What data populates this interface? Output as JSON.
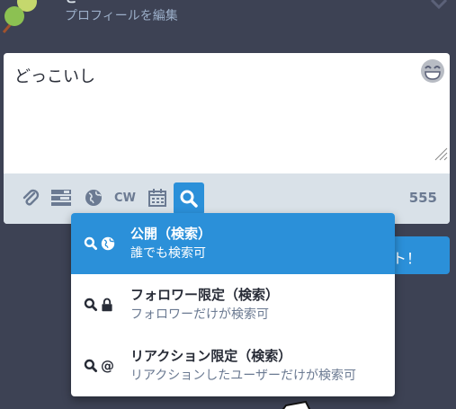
{
  "header": {
    "display_name": "さ",
    "edit_profile": "プロフィールを編集"
  },
  "compose": {
    "text": "どっこいし",
    "char_count": "555",
    "cw_label": "CW"
  },
  "toot_button": {
    "label": "ト！"
  },
  "visibility_menu": {
    "options": [
      {
        "title": "公開（検索）",
        "desc": "誰でも検索可",
        "icons": [
          "search-icon",
          "globe-icon"
        ],
        "selected": true
      },
      {
        "title": "フォロワー限定（検索）",
        "desc": "フォロワーだけが検索可",
        "icons": [
          "search-icon",
          "lock-icon"
        ],
        "selected": false
      },
      {
        "title": "リアクション限定（検索）",
        "desc": "リアクションしたユーザーだけが検索可",
        "icons": [
          "search-icon",
          "at-icon"
        ],
        "selected": false
      }
    ]
  },
  "colors": {
    "background": "#3d4254",
    "accent": "#2b90d9",
    "toolbar": "#d9e1e8",
    "muted": "#6b7a92"
  }
}
